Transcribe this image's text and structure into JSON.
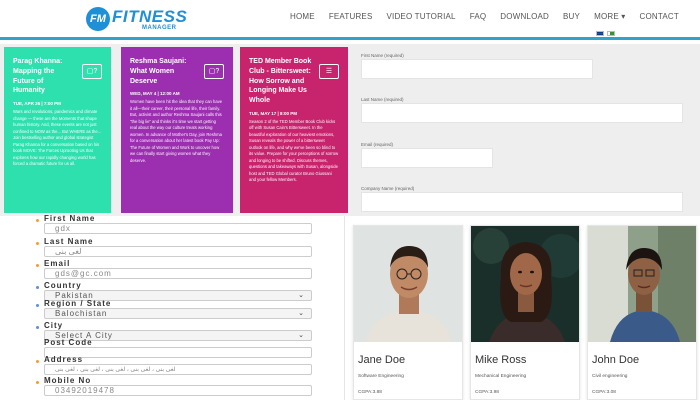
{
  "brand": {
    "logo_badge": "FM",
    "name": "FITNESS",
    "sub": "MANAGER"
  },
  "nav": [
    "HOME",
    "FEATURES",
    "VIDEO TUTORIAL",
    "FAQ",
    "DOWNLOAD",
    "BUY",
    "MORE ▾",
    "CONTACT"
  ],
  "cards": [
    {
      "title": "Parag Khanna: Mapping the Future of Humanity",
      "date": "TUE, APR 26 | 7:00 PM",
      "desc": "Wars and revolutions, pandemics and climate change — these are the Moments that shape human history. And, these events are not just confined to NOW as the... But WHERE as the... Join bestselling author and global strategist Parag Khanna for a conversation based on his book MOVE: The Forces Uprooting Us that explores how our rapidly changing world has forced a dramatic future for us all.",
      "icon": "chat-bubbles-icon",
      "color": "#2ee0ae"
    },
    {
      "title": "Reshma Saujani: What Women Deserve",
      "date": "WED, MAY 4 | 12:00 AM",
      "desc": "Women have been hit the idea that they can have it all—their career, their personal life, their family. But, activist and author Reshma Saujani calls this \"the big lie\" and thinks it's time we start getting real about the way our culture treats working women. In advance of Mother's Day, join Reshma for a conversation about her latest book Pay Up: The Future of Women and Work to uncover how we can finally start giving women what they deserve.",
      "icon": "chat-bubbles-icon",
      "color": "#9b2fb0"
    },
    {
      "title": "TED Member Book Club - Bittersweet: How Sorrow and Longing Make Us Whole",
      "date": "TUE, MAY 17 | 8:00 PM",
      "desc": "Season 2 of the TED Member Book Club kicks off with Susan Cain's Bittersweet. In the beautiful exploration of our heaviest emotions, Susan reveals the power of a bittersweet outlook on life, and why we've been so blind to its value. Prepare for your perceptions of sorrow and longing to be shifted. Discuss themes, questions and takeaways with Susan, alongside host and TED Global curator Bruno Giussani and your fellow Members.",
      "icon": "book-icon",
      "color": "#c8246e"
    }
  ],
  "right_form": {
    "first_name": "First Name (required)",
    "last_name": "Last Name (required)",
    "email": "Email (required)",
    "company": "Company Name (required)"
  },
  "left_form": {
    "fields": [
      {
        "label": "First Name",
        "value": "gdx"
      },
      {
        "label": "Last Name",
        "value": "لغی بنی"
      },
      {
        "label": "Email",
        "value": "gds@gc.com"
      },
      {
        "label": "Country",
        "value": "Pakistan"
      },
      {
        "label": "Region / State",
        "value": "Balochistan"
      },
      {
        "label": "City",
        "value": "Select A City"
      },
      {
        "label": "Post Code",
        "value": ""
      },
      {
        "label": "Address",
        "value": "لغی بنی ، لغی بنی ، لغی بنی ، لغی بنی ، لغی بنی"
      },
      {
        "label": "Mobile No",
        "value": "03492019478"
      }
    ]
  },
  "team": [
    {
      "name": "Jane Doe",
      "major": "Software Engineering",
      "gpa": "CGPA:3.88"
    },
    {
      "name": "Mike Ross",
      "major": "Mechanical Engineering",
      "gpa": "CGPA:3.98"
    },
    {
      "name": "John Doe",
      "major": "Civil engineering",
      "gpa": "CGPA:3.08"
    }
  ]
}
